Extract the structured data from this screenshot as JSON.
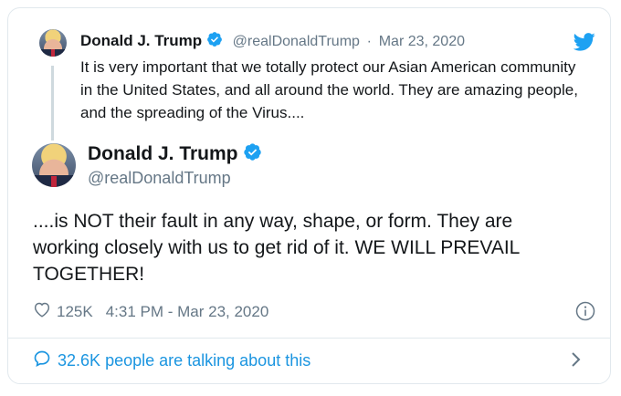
{
  "quoted": {
    "name": "Donald J. Trump",
    "handle": "@realDonaldTrump",
    "separator": "·",
    "date": "Mar 23, 2020",
    "text": "It is very important that we totally protect our Asian American community in the United States, and all around the world. They are amazing people, and the spreading of the Virus...."
  },
  "main": {
    "name": "Donald J. Trump",
    "handle": "@realDonaldTrump",
    "text": "....is NOT their fault in any way, shape, or form. They are working closely with us to get rid of it. WE WILL PREVAIL TOGETHER!"
  },
  "meta": {
    "likes": "125K",
    "time": "4:31 PM - Mar 23, 2020"
  },
  "footer": {
    "talking_count": "32.6K",
    "talking_label": "people are talking about this"
  },
  "colors": {
    "brand": "#1da1f2",
    "link": "#1b95e0",
    "muted": "#657786",
    "text": "#14171a"
  },
  "icons": [
    "verified-badge-icon",
    "twitter-bird-icon",
    "heart-icon",
    "info-icon",
    "speech-bubble-icon",
    "chevron-right-icon"
  ]
}
